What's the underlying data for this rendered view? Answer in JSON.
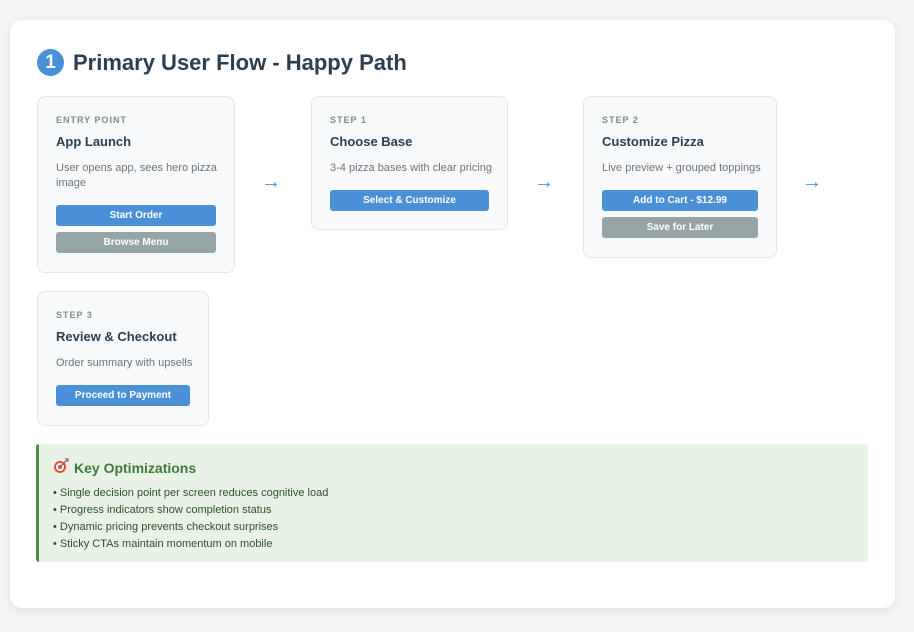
{
  "header": {
    "number": "1",
    "title": "Primary User Flow - Happy Path"
  },
  "arrow": "→",
  "cards": [
    {
      "label": "ENTRY POINT",
      "name": "App Launch",
      "desc": "User opens app, sees hero pizza image",
      "buttons": [
        {
          "text": "Start Order"
        },
        {
          "text": "Browse Menu"
        }
      ]
    },
    {
      "label": "STEP 1",
      "name": "Choose Base",
      "desc": "3-4 pizza bases with clear pricing",
      "buttons": [
        {
          "text": "Select & Customize"
        }
      ]
    },
    {
      "label": "STEP 2",
      "name": "Customize Pizza",
      "desc": "Live preview + grouped toppings",
      "buttons": [
        {
          "text": "Add to Cart - $12.99"
        },
        {
          "text": "Save for Later"
        }
      ]
    },
    {
      "label": "STEP 3",
      "name": "Review & Checkout",
      "desc": "Order summary with upsells",
      "buttons": [
        {
          "text": "Proceed to Payment"
        }
      ]
    }
  ],
  "optimizations": {
    "icon": "target-icon",
    "title": "Key Optimizations",
    "items": [
      "• Single decision point per screen reduces cognitive load",
      "• Progress indicators show completion status",
      "• Dynamic pricing prevents checkout surprises",
      "• Sticky CTAs maintain momentum on mobile"
    ]
  },
  "colors": {
    "primary": "#4a90d9",
    "secondary": "#95a5a6",
    "success": "#4f8a4b"
  }
}
